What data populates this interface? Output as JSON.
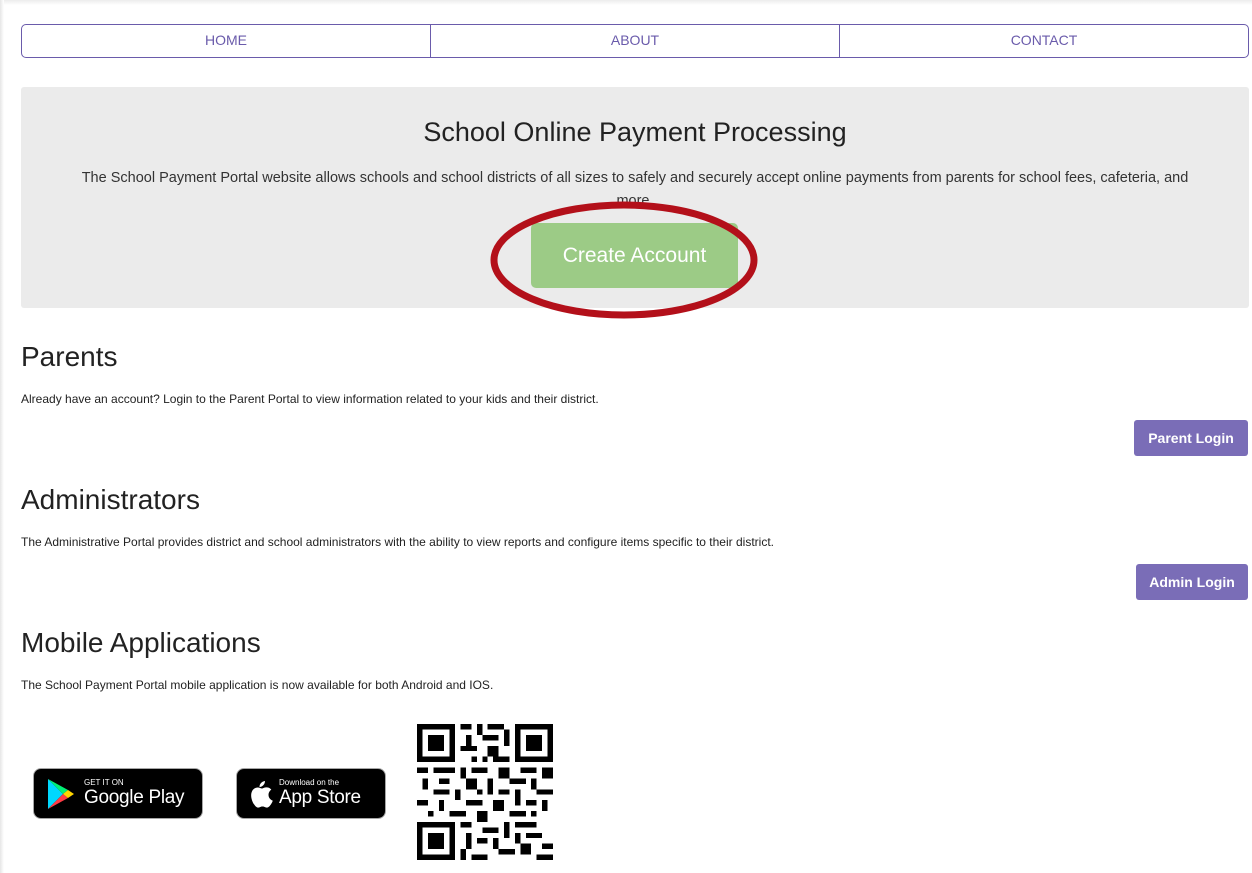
{
  "nav": {
    "items": [
      {
        "label": "HOME"
      },
      {
        "label": "ABOUT"
      },
      {
        "label": "CONTACT"
      }
    ]
  },
  "hero": {
    "title": "School Online Payment Processing",
    "description": "The School Payment Portal website allows schools and school districts of all sizes to safely and securely accept online payments from parents for school fees, cafeteria, and more.",
    "cta_label": "Create Account"
  },
  "parents": {
    "title": "Parents",
    "text": "Already have an account? Login to the Parent Portal to view information related to your kids and their district.",
    "button_label": "Parent Login"
  },
  "administrators": {
    "title": "Administrators",
    "text": "The Administrative Portal provides district and school administrators with the ability to view reports and configure items specific to their district.",
    "button_label": "Admin Login"
  },
  "mobile": {
    "title": "Mobile Applications",
    "text": "The School Payment Portal mobile application is now available for both Android and IOS.",
    "google_play": {
      "small": "GET IT ON",
      "big": "Google Play"
    },
    "app_store": {
      "small": "Download on the",
      "big": "App Store"
    }
  },
  "colors": {
    "accent": "#6a5bab",
    "button": "#7a6db7",
    "cta": "#9ccb86",
    "hero_bg": "#ebebeb",
    "annotation": "#b3101a"
  }
}
